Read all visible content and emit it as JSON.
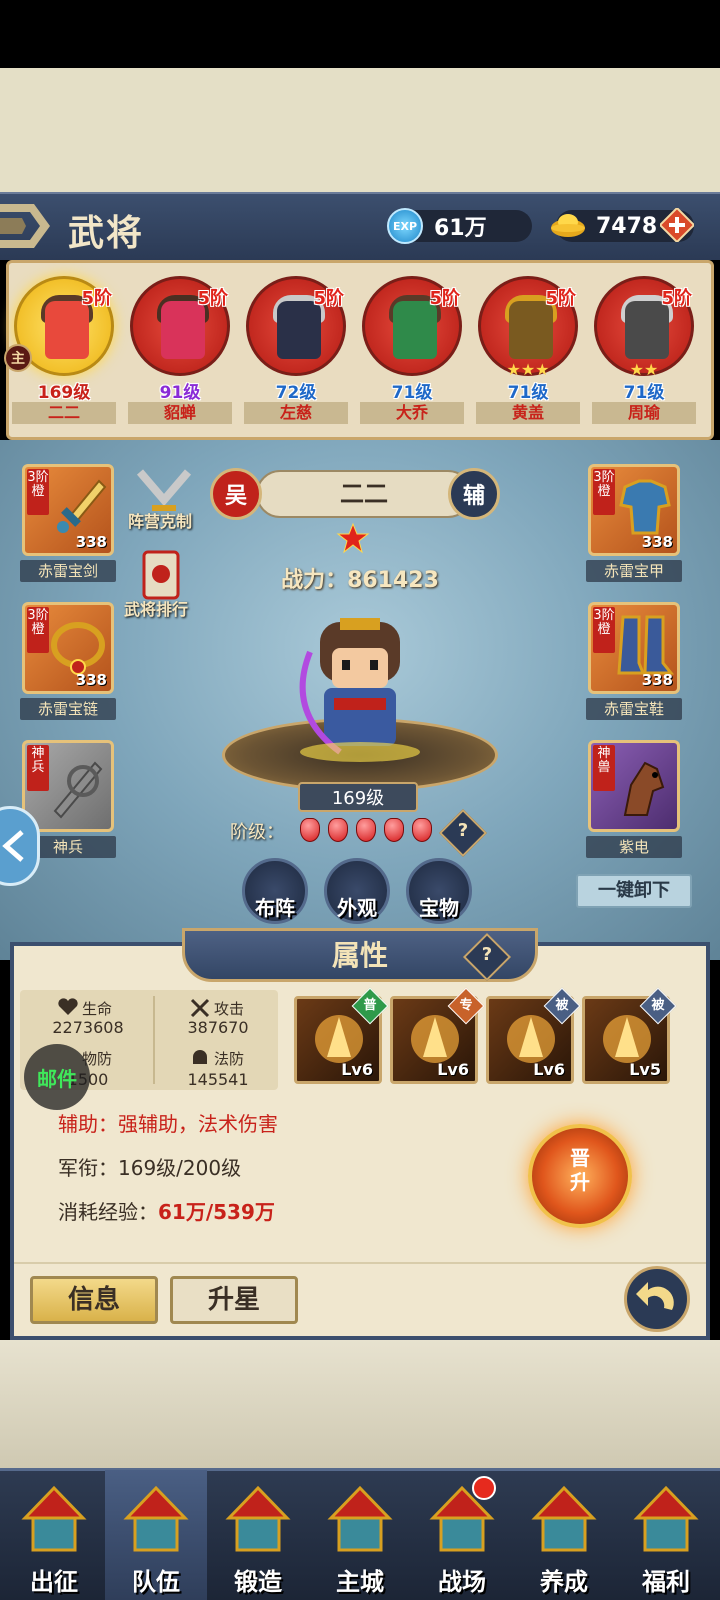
{
  "header": {
    "title": "武将",
    "exp_icon": "EXP",
    "exp_value": "61万",
    "gold_value": "7478"
  },
  "heroes": [
    {
      "grade": "5阶",
      "level": "169级",
      "name": "二二",
      "selected": true,
      "stars": "",
      "level_color": "#c8221a",
      "hair": "#5a3a28",
      "face": "#e8493c"
    },
    {
      "grade": "5阶",
      "level": "91级",
      "name": "貂蝉",
      "selected": false,
      "stars": "",
      "level_color": "#8a2bd6",
      "hair": "#4a2f22",
      "face": "#d9335a"
    },
    {
      "grade": "5阶",
      "level": "72级",
      "name": "左慈",
      "selected": false,
      "stars": "",
      "level_color": "#1e68c8",
      "hair": "#c9c9c9",
      "face": "#2a3048"
    },
    {
      "grade": "5阶",
      "level": "71级",
      "name": "大乔",
      "selected": false,
      "stars": "",
      "level_color": "#1e68c8",
      "hair": "#5a3a28",
      "face": "#2f8a4a"
    },
    {
      "grade": "5阶",
      "level": "71级",
      "name": "黄盖",
      "selected": false,
      "stars": "★★★",
      "level_color": "#1e68c8",
      "hair": "#d8a020",
      "face": "#7a5a20"
    },
    {
      "grade": "5阶",
      "level": "71级",
      "name": "周瑜",
      "selected": false,
      "stars": "★★",
      "level_color": "#1e68c8",
      "hair": "#cfcfcf",
      "face": "#4a4a4a"
    }
  ],
  "master_badge": "主",
  "equipment": {
    "weapon": {
      "rank": "3阶橙",
      "count": "338",
      "label": "赤雷宝剑"
    },
    "necklace": {
      "rank": "3阶橙",
      "count": "338",
      "label": "赤雷宝链"
    },
    "divine": {
      "rank": "神兵",
      "label": "神兵"
    },
    "armor": {
      "rank": "3阶橙",
      "count": "338",
      "label": "赤雷宝甲"
    },
    "boots": {
      "rank": "3阶橙",
      "count": "338",
      "label": "赤雷宝鞋"
    },
    "mount": {
      "rank": "神兽",
      "label": "紫电"
    }
  },
  "side_buttons": {
    "faction_counter": "阵营克制",
    "ranking": "武将排行"
  },
  "hero_detail": {
    "faction": "吴",
    "name": "二二",
    "role": "辅",
    "power": "战力：861423",
    "level_tag": "169级",
    "stage_label": "阶级：",
    "gems": 5
  },
  "action_buttons": {
    "formation": "布阵",
    "appearance": "外观",
    "treasure": "宝物",
    "unequip_all": "一键卸下"
  },
  "attributes": {
    "tab_title": "属性",
    "help": "?",
    "hp_label": "生命",
    "hp_value": "2273608",
    "atk_label": "攻击",
    "atk_value": "387670",
    "pdef_label": "物防",
    "pdef_value": "1500",
    "mdef_label": "法防",
    "mdef_value": "145541",
    "skills": [
      {
        "tag": "普",
        "tag_color": "#2f9a4a",
        "level": "Lv6"
      },
      {
        "tag": "专",
        "tag_color": "#c8622a",
        "level": "Lv6"
      },
      {
        "tag": "被",
        "tag_color": "#4a5f84",
        "level": "Lv6"
      },
      {
        "tag": "被",
        "tag_color": "#4a5f84",
        "level": "Lv5"
      }
    ],
    "role_desc_label": "辅助：",
    "role_desc_value": "强辅助，法术伤害",
    "rank_label": "军衔：",
    "rank_value": "169级/200级",
    "exp_cost_label": "消耗经验：",
    "exp_cost_value": "61万/539万",
    "promote": "晋升"
  },
  "mail": "邮件",
  "tabs": {
    "info": "信息",
    "star_up": "升星"
  },
  "nav": [
    {
      "label": "出征",
      "active": false
    },
    {
      "label": "队伍",
      "active": true
    },
    {
      "label": "锻造",
      "active": false
    },
    {
      "label": "主城",
      "active": false
    },
    {
      "label": "战场",
      "active": false
    },
    {
      "label": "养成",
      "active": false
    },
    {
      "label": "福利",
      "active": false
    }
  ]
}
